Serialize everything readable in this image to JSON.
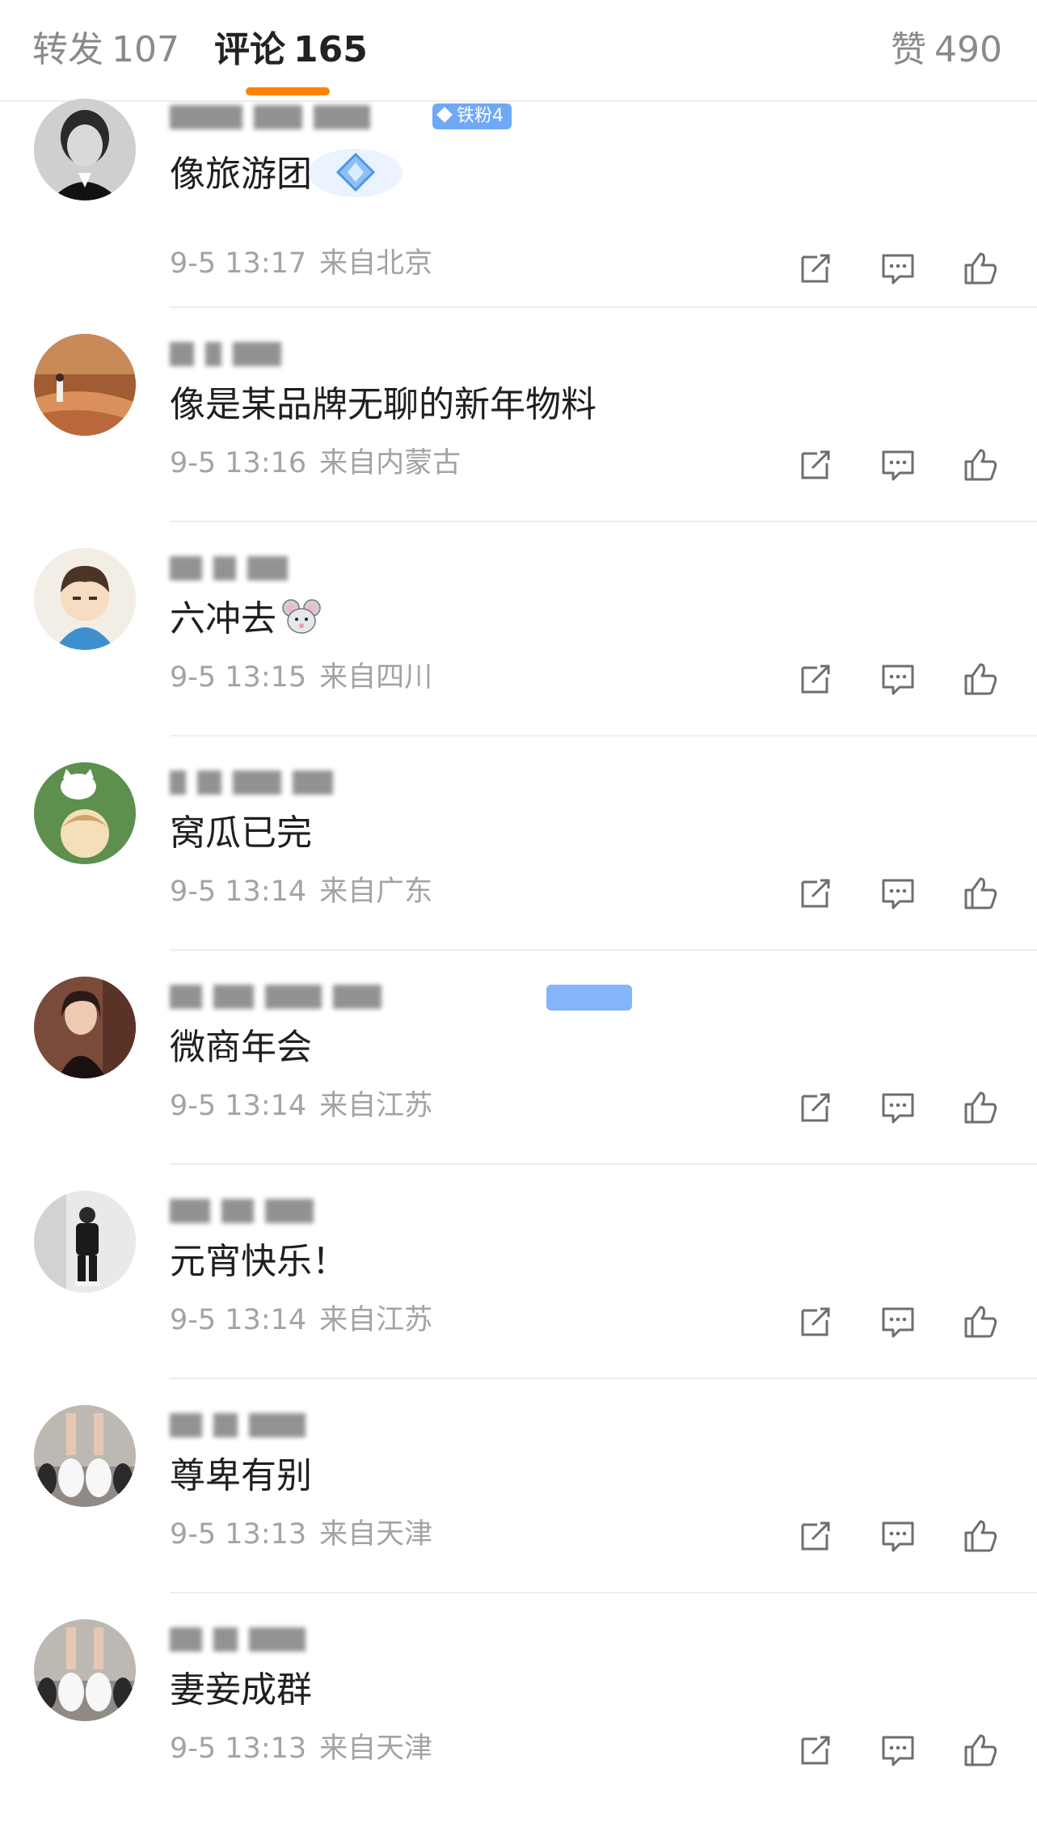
{
  "tabs": {
    "repost": {
      "label": "转发",
      "count": "107"
    },
    "comment": {
      "label": "评论",
      "count": "165"
    },
    "like": {
      "label": "赞",
      "count": "490"
    }
  },
  "colors": {
    "accent": "#ff8200",
    "badge": "#6fa8f7",
    "meta_text": "#a3a3a3"
  },
  "comments": [
    {
      "badge": "铁粉4",
      "text": "像旅游团",
      "time": "9-5 13:17",
      "location": "来自北京",
      "avatar": "avatar-bw-portrait",
      "sticker": "diamond-sticker"
    },
    {
      "text": "像是某品牌无聊的新年物料",
      "time": "9-5 13:16",
      "location": "来自内蒙古",
      "avatar": "avatar-desert"
    },
    {
      "text": "六冲去",
      "emoji": "mouse-face-emoji",
      "time": "9-5 13:15",
      "location": "来自四川",
      "avatar": "avatar-cartoon-boy"
    },
    {
      "text": "窝瓜已完",
      "time": "9-5 13:14",
      "location": "来自广东",
      "avatar": "avatar-anime-cat"
    },
    {
      "text": "微商年会",
      "time": "9-5 13:14",
      "location": "来自江苏",
      "avatar": "avatar-woman"
    },
    {
      "text": "元宵快乐！",
      "time": "9-5 13:14",
      "location": "来自江苏",
      "avatar": "avatar-man-black"
    },
    {
      "text": "尊卑有别",
      "time": "9-5 13:13",
      "location": "来自天津",
      "avatar": "avatar-shoes"
    },
    {
      "text": "妻妾成群",
      "time": "9-5 13:13",
      "location": "来自天津",
      "avatar": "avatar-shoes"
    }
  ]
}
